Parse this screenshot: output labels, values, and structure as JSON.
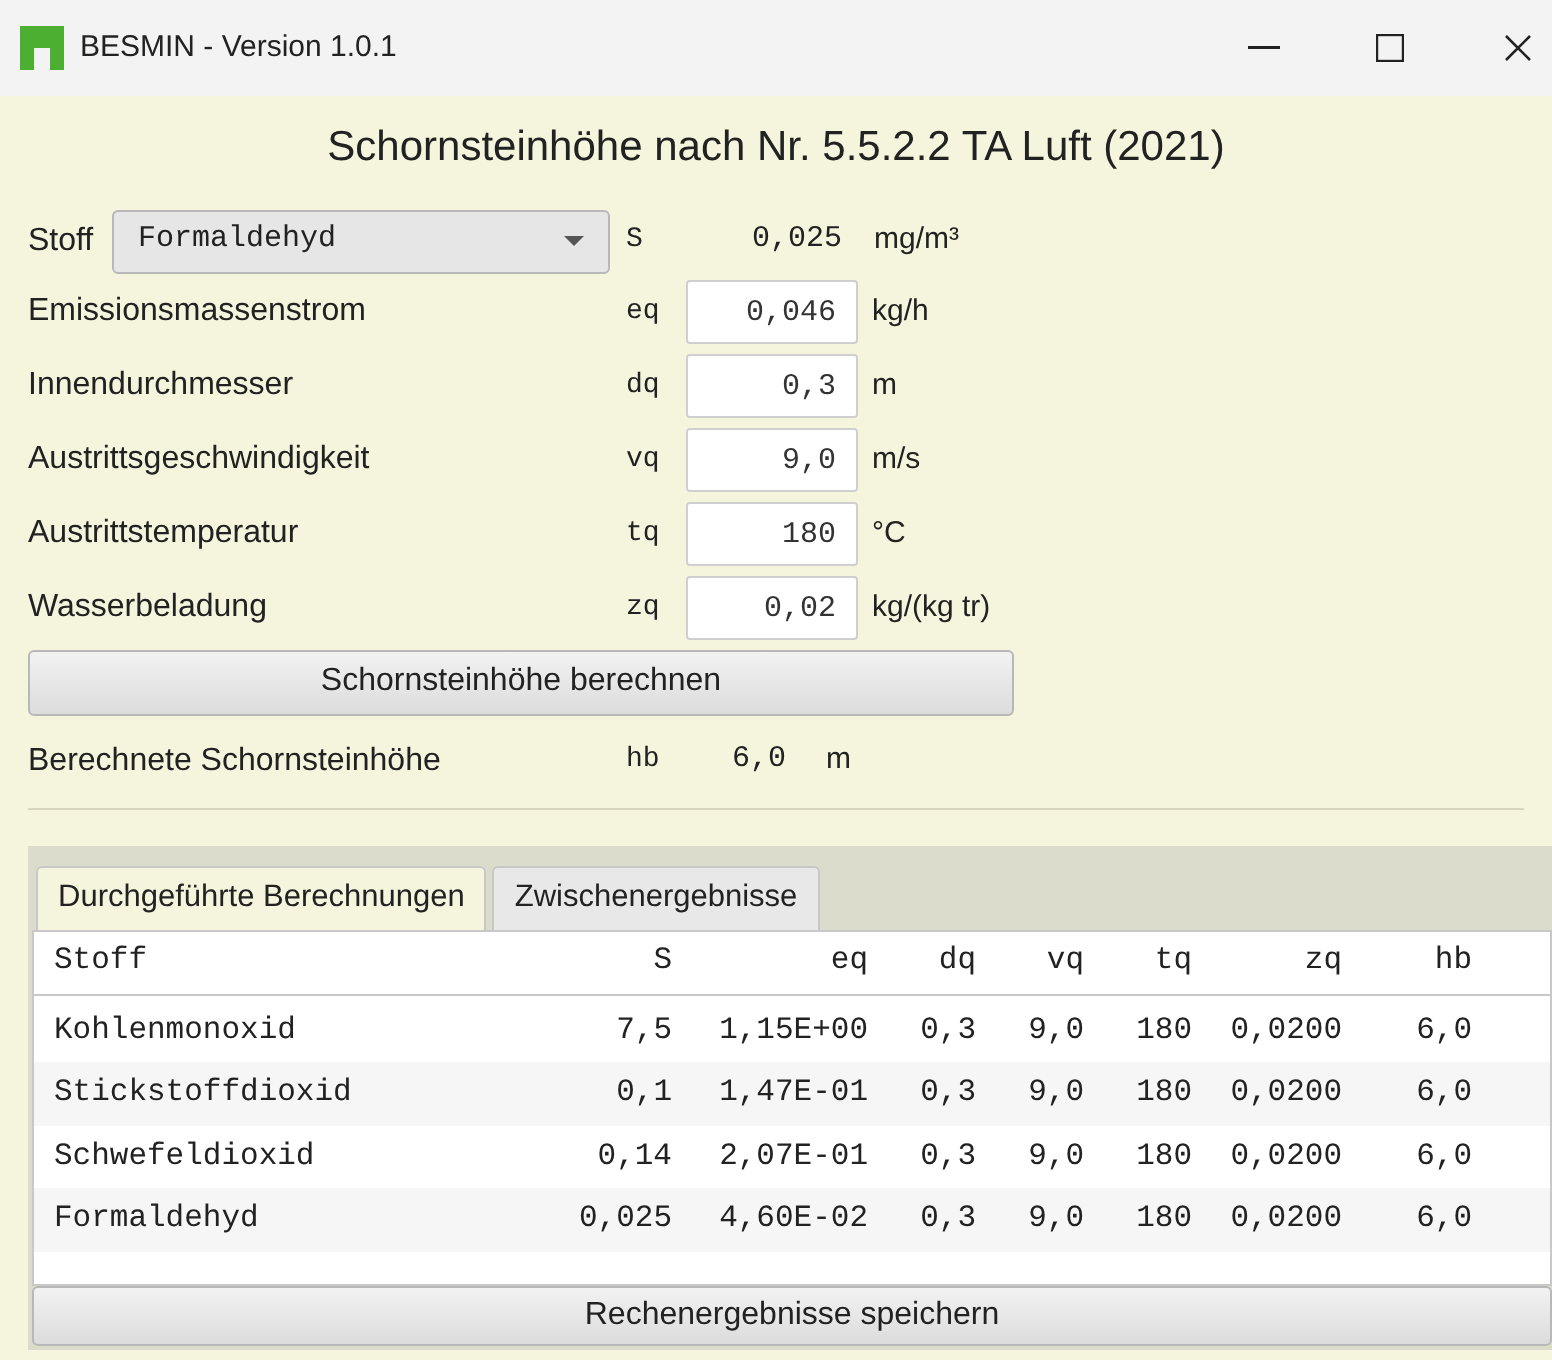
{
  "window": {
    "title": "BESMIN - Version 1.0.1"
  },
  "heading": "Schornsteinhöhe nach Nr. 5.5.2.2 TA Luft (2021)",
  "substance": {
    "label": "Stoff",
    "value": "Formaldehyd",
    "symbol": "S",
    "reading": "0,025",
    "unit": "mg/m³"
  },
  "inputs": [
    {
      "label": "Emissionsmassenstrom",
      "symbol": "eq",
      "value": "0,046",
      "unit": "kg/h"
    },
    {
      "label": "Innendurchmesser",
      "symbol": "dq",
      "value": "0,3",
      "unit": "m"
    },
    {
      "label": "Austrittsgeschwindigkeit",
      "symbol": "vq",
      "value": "9,0",
      "unit": "m/s"
    },
    {
      "label": "Austrittstemperatur",
      "symbol": "tq",
      "value": "180",
      "unit": "°C"
    },
    {
      "label": "Wasserbeladung",
      "symbol": "zq",
      "value": "0,02",
      "unit": "kg/(kg tr)"
    }
  ],
  "calculate_button": "Schornsteinhöhe berechnen",
  "result": {
    "label": "Berechnete Schornsteinhöhe",
    "symbol": "hb",
    "value": "6,0",
    "unit": "m"
  },
  "tabs": [
    {
      "label": "Durchgeführte Berechnungen",
      "selected": true
    },
    {
      "label": "Zwischenergebnisse",
      "selected": false
    }
  ],
  "table": {
    "columns": [
      "Stoff",
      "S",
      "eq",
      "dq",
      "vq",
      "tq",
      "zq",
      "hb"
    ],
    "rows": [
      [
        "Kohlenmonoxid",
        "7,5",
        "1,15E+00",
        "0,3",
        "9,0",
        "180",
        "0,0200",
        "6,0"
      ],
      [
        "Stickstoffdioxid",
        "0,1",
        "1,47E-01",
        "0,3",
        "9,0",
        "180",
        "0,0200",
        "6,0"
      ],
      [
        "Schwefeldioxid",
        "0,14",
        "2,07E-01",
        "0,3",
        "9,0",
        "180",
        "0,0200",
        "6,0"
      ],
      [
        "Formaldehyd",
        "0,025",
        "4,60E-02",
        "0,3",
        "9,0",
        "180",
        "0,0200",
        "6,0"
      ]
    ]
  },
  "save_button": "Rechenergebnisse speichern"
}
